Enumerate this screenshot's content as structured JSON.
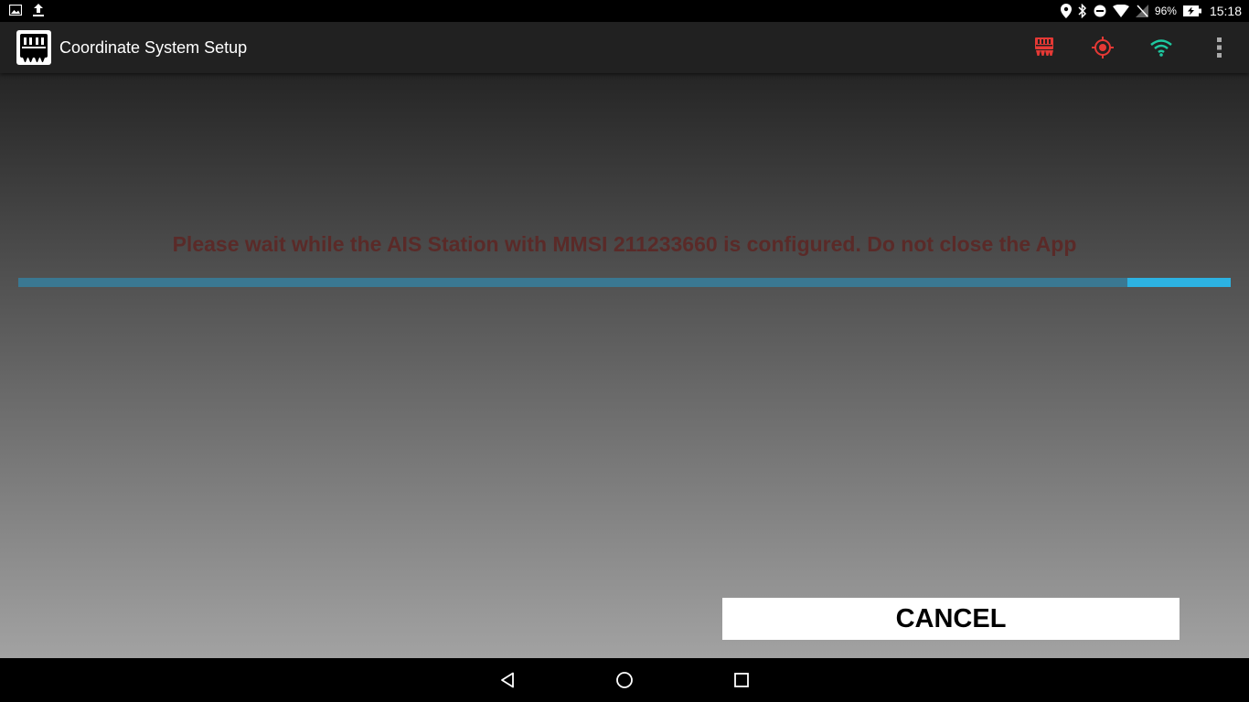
{
  "status_bar": {
    "left_icons": [
      "image-icon",
      "upload-icon"
    ],
    "right_icons": [
      "location-icon",
      "bluetooth-icon",
      "do-not-disturb-icon",
      "wifi-signal-icon",
      "no-sim-icon"
    ],
    "battery": "96%",
    "time": "15:18"
  },
  "toolbar": {
    "title": "Coordinate System Setup",
    "actions": [
      "connector-icon",
      "gps-target-icon",
      "wifi-icon",
      "overflow-menu-icon"
    ]
  },
  "colors": {
    "message": "#5a2a28",
    "progress_primary": "#3a7892",
    "progress_buffer": "#2cb2e2",
    "action_red": "#e53935",
    "action_teal": "#1ec8a0"
  },
  "main": {
    "message": "Please wait while the AIS Station with MMSI 211233660 is configured. Do not close the App",
    "progress": 0.915,
    "cancel_label": "CANCEL"
  },
  "nav_bar": {
    "buttons": [
      "back-icon",
      "home-icon",
      "recents-icon"
    ]
  }
}
